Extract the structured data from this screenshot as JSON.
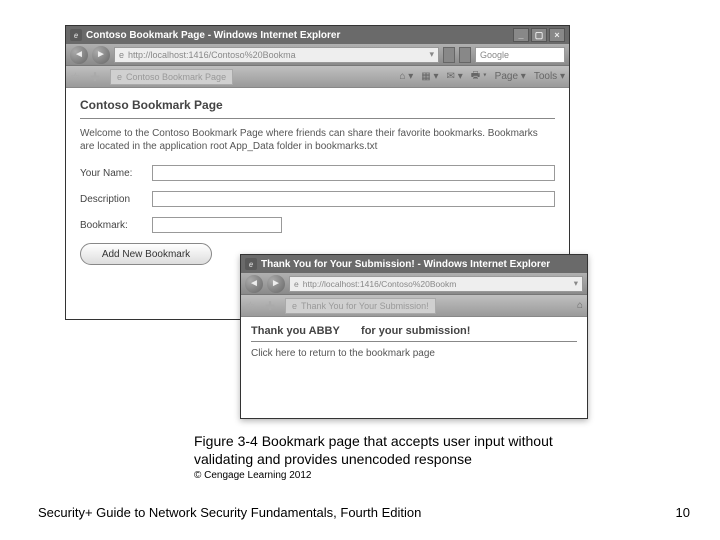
{
  "mainWindow": {
    "title": "Contoso Bookmark Page - Windows Internet Explorer",
    "url": "http://localhost:1416/Contoso%20Bookma",
    "searchPlaceholder": "Google",
    "tabTitle": "Contoso Bookmark Page",
    "tools": {
      "page": "Page",
      "tools": "Tools"
    },
    "heading": "Contoso Bookmark Page",
    "intro": "Welcome to the Contoso Bookmark Page where friends can share their favorite bookmarks. Bookmarks are located in the application root App_Data folder in bookmarks.txt",
    "labels": {
      "name": "Your Name:",
      "desc": "Description",
      "bookmark": "Bookmark:"
    },
    "button": "Add New Bookmark"
  },
  "popup": {
    "title": "Thank You for Your Submission! - Windows Internet Explorer",
    "url": "http://localhost:1416/Contoso%20Bookm",
    "tabTitle": "Thank You for Your Submission!",
    "thankPrefix": "Thank you ABBY",
    "thankSuffix": "for your submission!",
    "returnLink": "Click here to return to the bookmark page"
  },
  "caption": "Figure 3-4 Bookmark page that accepts user input without validating and provides unencoded response",
  "copyright": "© Cengage Learning 2012",
  "footer": "Security+ Guide to Network Security Fundamentals, Fourth Edition",
  "pageNum": "10"
}
